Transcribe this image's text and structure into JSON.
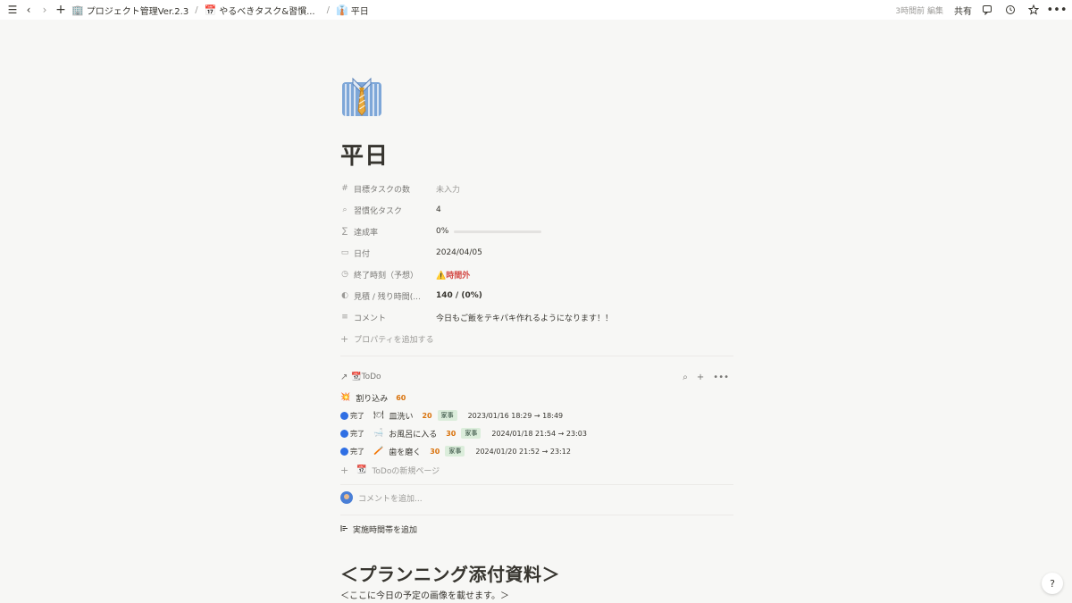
{
  "topbar": {
    "breadcrumbs": [
      {
        "emoji": "🏢",
        "label": "プロジェクト管理Ver.2.3"
      },
      {
        "emoji": "📅",
        "label": "やるべきタスク&習慣..."
      },
      {
        "emoji": "👔",
        "label": "平日"
      }
    ],
    "separator": "/",
    "edited": "3時間前 編集",
    "share": "共有"
  },
  "page": {
    "icon": "necktie-shirt-icon",
    "title": "平日"
  },
  "properties": [
    {
      "icon": "#",
      "name": "目標タスクの数",
      "value": "未入力",
      "style": "empty"
    },
    {
      "icon": "⌕",
      "name": "習慣化タスク",
      "value": "4",
      "style": ""
    },
    {
      "icon": "∑",
      "name": "達成率",
      "value": "0%",
      "style": "progress",
      "progress": 0
    },
    {
      "icon": "▭",
      "name": "日付",
      "value": "2024/04/05",
      "style": ""
    },
    {
      "icon": "◷",
      "name": "終了時刻（予想）",
      "value": "⚠️時間外",
      "style": "warn"
    },
    {
      "icon": "◐",
      "name": "見積 / 残り時間(...",
      "value": "140 / (0%)",
      "style": "bold"
    },
    {
      "icon": "≡",
      "name": "コメント",
      "value": "今日もご飯をテキパキ作れるようになります！！",
      "style": ""
    }
  ],
  "add_property": "プロパティを追加する",
  "database": {
    "arrow": "↗",
    "emoji": "📆",
    "title": "ToDo",
    "rows": [
      {
        "status": "",
        "emoji": "💥",
        "name": "割り込み",
        "num": "60",
        "tag": "",
        "date": ""
      },
      {
        "status": "完了",
        "emoji": "🍽",
        "name": "皿洗い",
        "num": "20",
        "tag": "家事",
        "date": "2023/01/16 18:29 → 18:49"
      },
      {
        "status": "完了",
        "emoji": "🛁",
        "name": "お風呂に入る",
        "num": "30",
        "tag": "家事",
        "date": "2024/01/18 21:54 → 23:03"
      },
      {
        "status": "完了",
        "emoji": "🪥",
        "name": "歯を磨く",
        "num": "30",
        "tag": "家事",
        "date": "2024/01/20 21:52 → 23:12"
      }
    ],
    "new_page_emoji": "📆",
    "new_page": "ToDoの新規ページ"
  },
  "comment_placeholder": "コメントを追加...",
  "timeband": "実施時間帯を追加",
  "heading": "＜プランニング添付資料＞",
  "paragraph": "＜ここに今日の予定の画像を載せます。＞",
  "help": "?"
}
